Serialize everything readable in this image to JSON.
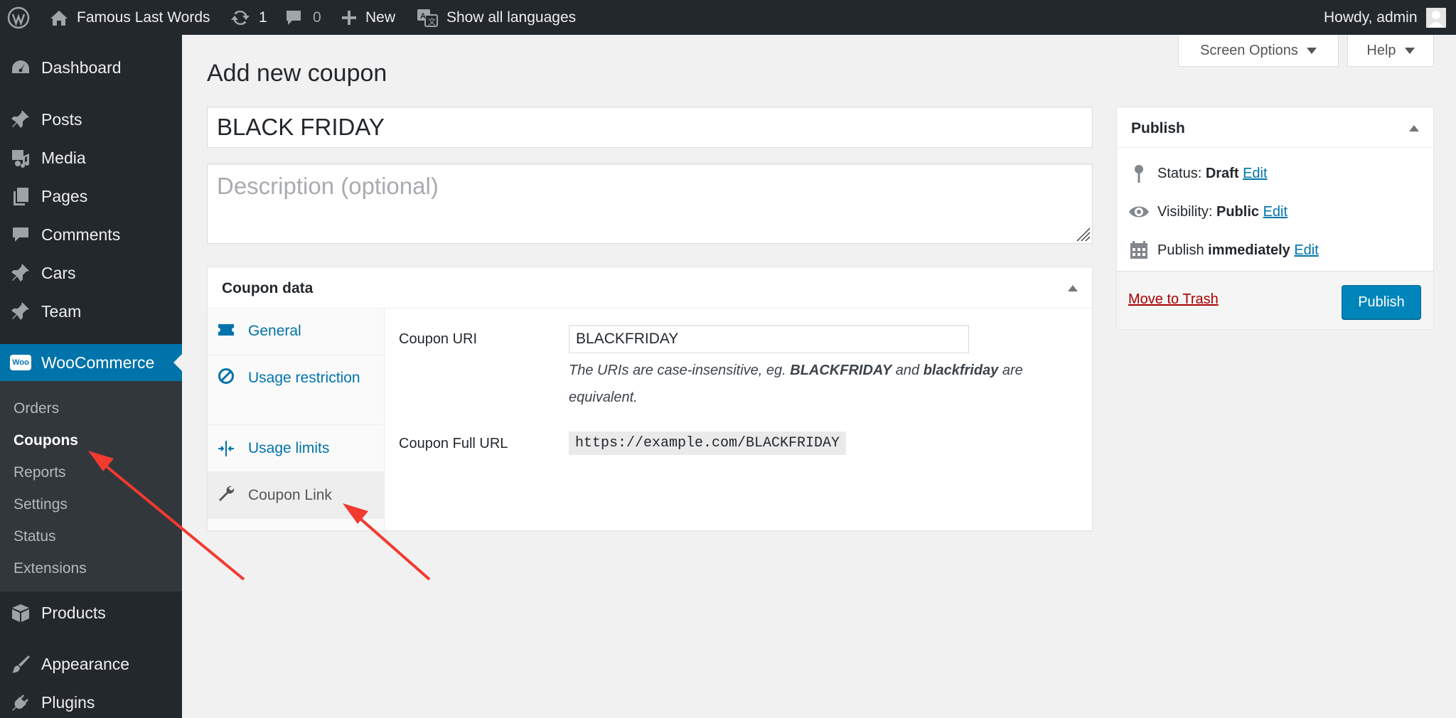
{
  "admin_bar": {
    "site_name": "Famous Last Words",
    "updates_count": "1",
    "comments_count": "0",
    "new_label": "New",
    "languages_label": "Show all languages",
    "greeting": "Howdy, admin"
  },
  "sidebar": {
    "items": [
      {
        "label": "Dashboard",
        "icon": "dashboard-icon"
      },
      {
        "label": "Posts",
        "icon": "pin-icon"
      },
      {
        "label": "Media",
        "icon": "media-icon"
      },
      {
        "label": "Pages",
        "icon": "pages-icon"
      },
      {
        "label": "Comments",
        "icon": "comment-icon"
      },
      {
        "label": "Cars",
        "icon": "pin-icon"
      },
      {
        "label": "Team",
        "icon": "pin-icon"
      },
      {
        "label": "WooCommerce",
        "icon": "woo-icon",
        "current": true
      },
      {
        "label": "Products",
        "icon": "box-icon"
      },
      {
        "label": "Appearance",
        "icon": "brush-icon"
      },
      {
        "label": "Plugins",
        "icon": "plug-icon"
      }
    ],
    "woo_icon_text": "Woo",
    "submenu": [
      "Orders",
      "Coupons",
      "Reports",
      "Settings",
      "Status",
      "Extensions"
    ],
    "submenu_active": "Coupons"
  },
  "header": {
    "screen_options": "Screen Options",
    "help": "Help",
    "page_title": "Add new coupon"
  },
  "form": {
    "title_value": "BLACK FRIDAY",
    "description_placeholder": "Description (optional)"
  },
  "coupon_data": {
    "title": "Coupon data",
    "tabs": [
      {
        "label": "General",
        "icon": "ticket-icon"
      },
      {
        "label": "Usage restriction",
        "icon": "block-icon"
      },
      {
        "label": "Usage limits",
        "icon": "limits-icon"
      },
      {
        "label": "Coupon Link",
        "icon": "wrench-icon",
        "active": true
      }
    ],
    "uri_label": "Coupon URI",
    "uri_value": "BLACKFRIDAY",
    "help_part1": "The URIs are case-insensitive, eg.",
    "help_bold1": "BLACKFRIDAY",
    "help_part2": "and",
    "help_bold2": "blackfriday",
    "help_part3": "are equivalent.",
    "full_url_label": "Coupon Full URL",
    "full_url_value": "https://example.com/BLACKFRIDAY"
  },
  "publish": {
    "title": "Publish",
    "status_label": "Status:",
    "status_value": "Draft",
    "visibility_label": "Visibility:",
    "visibility_value": "Public",
    "schedule_label": "Publish",
    "schedule_value": "immediately",
    "edit_label": "Edit",
    "trash_label": "Move to Trash",
    "publish_button": "Publish"
  },
  "colors": {
    "admin_bar": "#23282d",
    "menu_current": "#0073aa",
    "link": "#0073aa",
    "primary_button": "#0085ba",
    "trash": "#a00000",
    "annotation_arrow": "#f23a2f"
  }
}
